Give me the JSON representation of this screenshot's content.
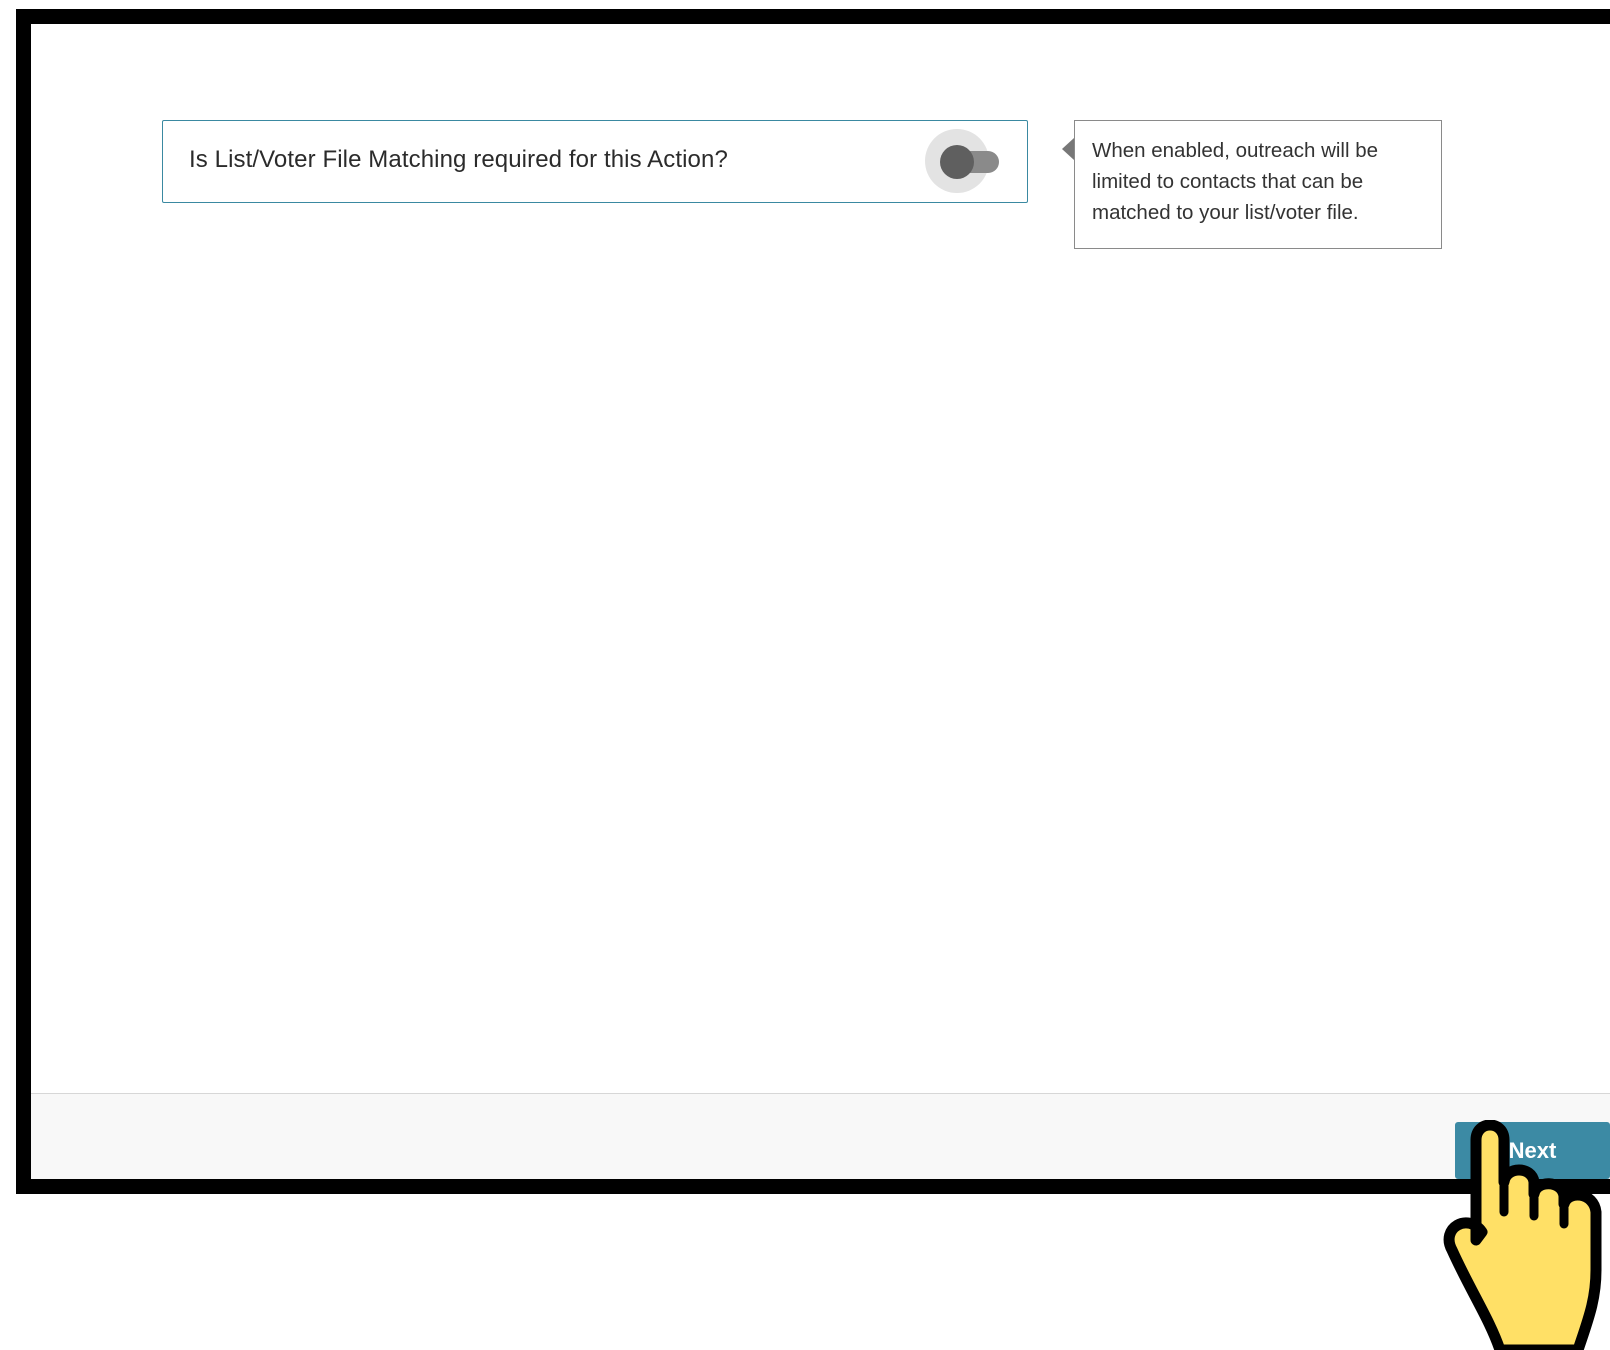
{
  "question": {
    "text": "Is List/Voter File Matching required for this Action?",
    "toggle_enabled": false
  },
  "tooltip": {
    "text": "When enabled, outreach will be limited to contacts that can be matched to your list/voter file."
  },
  "footer": {
    "next_label": "Next"
  },
  "colors": {
    "accent": "#3c8aa4",
    "card_border": "#3a89a1",
    "cursor_fill": "#ffe066"
  },
  "icons": {
    "cursor": "pointing-hand-cursor-icon"
  }
}
